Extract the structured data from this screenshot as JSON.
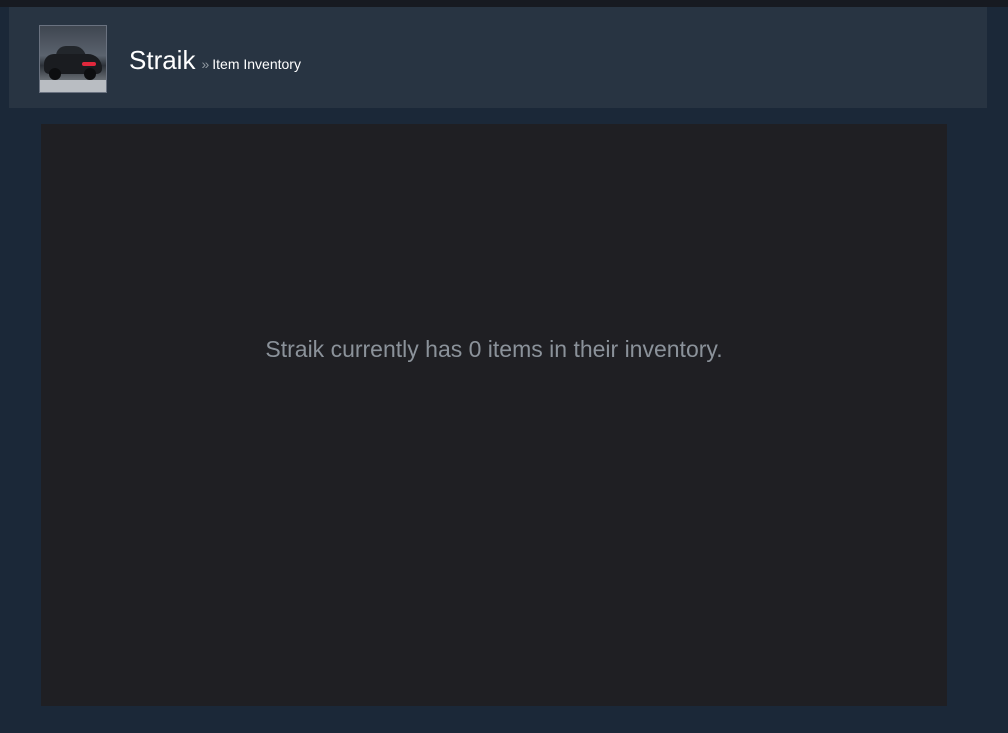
{
  "header": {
    "username": "Straik",
    "separator": "»",
    "subpage": "Item Inventory",
    "avatar_icon": "car-avatar-icon"
  },
  "inventory": {
    "empty_message": "Straik currently has 0 items in their inventory."
  },
  "colors": {
    "page_background": "#1b2838",
    "header_background": "#283442",
    "panel_background": "#1f1f23",
    "message_text": "#8b929a"
  }
}
